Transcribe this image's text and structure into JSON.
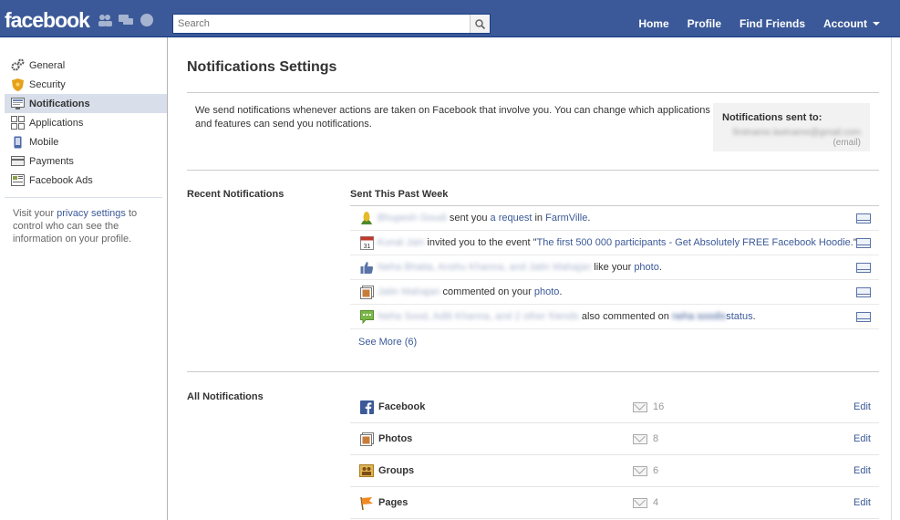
{
  "topbar": {
    "logo": "facebook",
    "search_placeholder": "Search",
    "nav": [
      "Home",
      "Profile",
      "Find Friends",
      "Account"
    ]
  },
  "sidebar": {
    "items": [
      {
        "label": "General",
        "icon": "gears-icon"
      },
      {
        "label": "Security",
        "icon": "shield-icon"
      },
      {
        "label": "Notifications",
        "icon": "notification-icon"
      },
      {
        "label": "Applications",
        "icon": "apps-icon"
      },
      {
        "label": "Mobile",
        "icon": "mobile-icon"
      },
      {
        "label": "Payments",
        "icon": "credit-card-icon"
      },
      {
        "label": "Facebook Ads",
        "icon": "ads-icon"
      }
    ],
    "note_pre": "Visit your ",
    "note_link": "privacy settings",
    "note_post": " to control who can see the information on your profile."
  },
  "main": {
    "title": "Notifications Settings",
    "intro": "We send notifications whenever actions are taken on Facebook that involve you. You can change which applications and features can send you notifications.",
    "sent_to_label": "Notifications sent to:",
    "sent_to_email": "firstname.lastname@gmail.com",
    "sent_to_suffix": "(email)",
    "recent_label": "Recent Notifications",
    "recent_head": "Sent This Past Week",
    "recent": [
      {
        "who": "Bhupesh Goudi",
        "pre": " sent you ",
        "link1": "a request",
        "mid": " in ",
        "link2": "FarmVille",
        "post": "."
      },
      {
        "who": "Kunal Jain",
        "pre": " invited you to the event \"",
        "link1": "The first 500 000 participants - Get Absolutely FREE Facebook Hoodie.",
        "mid": "",
        "link2": "",
        "post": "\""
      },
      {
        "who": "Neha Bhatia, Anshu Khanna, and Jatin Mahajan",
        "pre": " like your ",
        "link1": "photo",
        "mid": "",
        "link2": "",
        "post": "."
      },
      {
        "who": "Jatin Mahajan",
        "pre": " commented on your ",
        "link1": "photo",
        "mid": "",
        "link2": "",
        "post": "."
      },
      {
        "who": "Neha Sood, Aditi Khanna, and 2 other friends",
        "pre": " also commented on ",
        "link1": "neha soodis",
        "mid": "",
        "link2": "status",
        "post": "."
      }
    ],
    "see_more": "See More (6)",
    "all_label": "All Notifications",
    "all": [
      {
        "name": "Facebook",
        "count": "16",
        "edit": "Edit",
        "icon": "facebook-icon"
      },
      {
        "name": "Photos",
        "count": "8",
        "edit": "Edit",
        "icon": "photos-icon"
      },
      {
        "name": "Groups",
        "count": "6",
        "edit": "Edit",
        "icon": "groups-icon"
      },
      {
        "name": "Pages",
        "count": "4",
        "edit": "Edit",
        "icon": "pages-icon"
      }
    ]
  }
}
